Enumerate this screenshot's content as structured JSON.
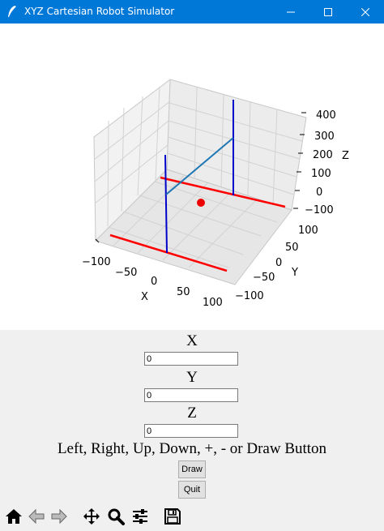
{
  "window": {
    "title": "XYZ Cartesian Robot Simulator"
  },
  "plot": {
    "x_label": "X",
    "y_label": "Y",
    "z_label": "Z",
    "x_ticks": [
      "−100",
      "−50",
      "0",
      "50",
      "100"
    ],
    "y_ticks": [
      "100",
      "50",
      "0",
      "−50",
      "−100"
    ],
    "z_ticks": [
      "400",
      "300",
      "200",
      "100",
      "0",
      "−100"
    ],
    "colors": {
      "rails": "#ff0000",
      "columns": "#0000cc",
      "arm": "#1f77b4",
      "point": "#ee0000"
    }
  },
  "controls": {
    "x_label": "X",
    "x_value": "0",
    "y_label": "Y",
    "y_value": "0",
    "z_label": "Z",
    "z_value": "0",
    "instructions": "Left, Right, Up, Down, +, - or Draw Button",
    "draw_label": "Draw",
    "quit_label": "Quit"
  },
  "toolbar": {
    "icons": [
      "home-icon",
      "back-arrow-icon",
      "forward-arrow-icon",
      "pan-icon",
      "zoom-icon",
      "configure-subplots-icon",
      "save-icon"
    ]
  }
}
